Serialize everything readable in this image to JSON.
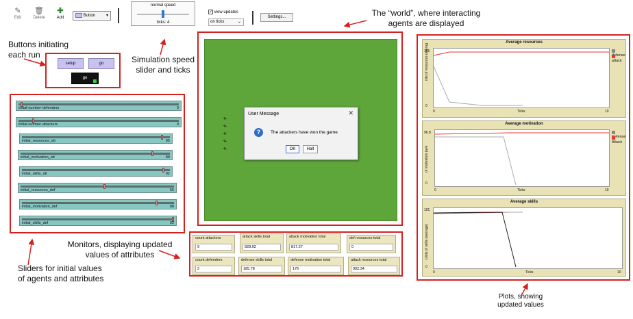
{
  "toolbar": {
    "edit": "Edit",
    "delete": "Delete",
    "add": "Add",
    "widget_select": "Button",
    "speed_label": "normal speed",
    "ticks": "ticks: 4",
    "view_updates": "view updates",
    "update_mode": "on ticks",
    "settings": "Settings..."
  },
  "buttons": {
    "setup": "setup",
    "go": "go",
    "go_forever": "go"
  },
  "sliders": [
    {
      "name": "initial-number-defenders",
      "value": "3",
      "fraction": 0.02
    },
    {
      "name": "initial-number-attackers",
      "value": "9",
      "fraction": 0.09
    },
    {
      "name": "initial_resources_att",
      "value": "95",
      "fraction": 0.95
    },
    {
      "name": "initial_motivation_att",
      "value": "88",
      "fraction": 0.88
    },
    {
      "name": "initial_skills_att",
      "value": "92",
      "fraction": 0.92
    },
    {
      "name": "initial_resources_def",
      "value": "55",
      "fraction": 0.55
    },
    {
      "name": "initial_motivation_def",
      "value": "88",
      "fraction": 0.88
    },
    {
      "name": "initial_skills_def",
      "value": "92",
      "fraction": 0.92
    }
  ],
  "monitors": [
    {
      "label": "count attackers",
      "value": "9"
    },
    {
      "label": "attack skills total",
      "value": "828.02"
    },
    {
      "label": "attack motivation total",
      "value": "817.27"
    },
    {
      "label": "def resources total",
      "value": "0"
    },
    {
      "label": "count defenders",
      "value": "2"
    },
    {
      "label": "defense skills total",
      "value": "185.78"
    },
    {
      "label": "defense motivation total",
      "value": "176"
    },
    {
      "label": "attack resources total",
      "value": "902.34"
    }
  ],
  "dialog": {
    "title": "User Message",
    "message": "The attackers have won the game",
    "ok": "OK",
    "halt": "Halt"
  },
  "plots": {
    "resources": {
      "title": "Average resources",
      "ylabel": "nits of resources (averag",
      "xlabel": "Ticks",
      "ymax": "105",
      "ymin": "0",
      "xmin": "0",
      "xmax": "10",
      "legend": [
        "defense",
        "attack"
      ]
    },
    "motivation": {
      "title": "Average motivation",
      "ylabel": "of motivation (ave",
      "xlabel": "Ticks",
      "ymax": "96.8",
      "ymin": "0",
      "xmin": "0",
      "xmax": "10",
      "legend": [
        "Defense",
        "Attack"
      ]
    },
    "skills": {
      "title": "Average skills",
      "ylabel": "Units of skills (average)",
      "xlabel": "Ticks",
      "ymax": "101",
      "ymin": "0",
      "xmin": "0",
      "xmax": "10"
    }
  },
  "annotations": {
    "world": "The “world”, where interacting\nagents are displayed",
    "buttons": "Buttons initiating\neach run",
    "speed": "Simulation speed\nslider and ticks",
    "monitors": "Monitors, displaying updated\nvalues of attributes",
    "sliders": "Sliders for initial values\nof agents and attributes",
    "plots": "Plots, showing\nupdated values"
  },
  "colors": {
    "world": "#5ea63a",
    "annot_red": "#d62020",
    "slider": "#86c7c1",
    "monitor": "#ece6bf",
    "plot_bg": "#e8e2b4",
    "button": "#c9c1ef"
  }
}
